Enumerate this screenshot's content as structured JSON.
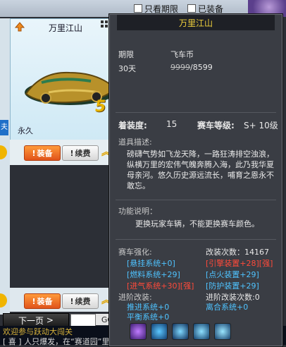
{
  "filters": {
    "only_expired": "只看期限",
    "equipped": "已装备"
  },
  "card": {
    "title": "万里江山",
    "duration": "永久",
    "level_badge": "5",
    "side_tab": "夫"
  },
  "rows": [
    {
      "equip": "装备",
      "renew": "续费"
    },
    {
      "equip": "装备",
      "renew": "续费"
    }
  ],
  "pager": {
    "next": "下一页",
    "go": "GC"
  },
  "chat": {
    "line1": "欢迎参与跃动大闯关",
    "line2": "[ 喜 ] 人只爆发，在“赛道园”里竞得都赢先一阶"
  },
  "tooltip": {
    "title": "万里江山",
    "period_label": "期限",
    "price_label": "飞车币",
    "period_value": "30天",
    "price_old": "9999",
    "price_new": "/8599",
    "wear_label": "着装度:",
    "wear_value": "15",
    "level_label": "赛车等级:",
    "level_value": "S+ 10级",
    "desc_heading": "道具描述:",
    "desc_text": "磅礴气势如飞龙天降，一路狂涛排空浊浪，纵横万里的宏伟气魄奔腾入海，此乃我华夏母亲河。悠久历史源远流长，哺育之恩永不敢忘。",
    "func_heading": "功能说明：",
    "func_text": "更换玩家车辆，不能更换赛车颜色。",
    "enhance_heading": "赛车强化:",
    "mod_count_label": "改装次数：",
    "mod_count_value": "14167",
    "enh_left": [
      "[悬挂系统+0]",
      "[燃料系统+29]",
      "[进气系统+30][强]"
    ],
    "enh_right": [
      "[引擎装置+28][强]",
      "[点火装置+29]",
      "[防护装置+29]"
    ],
    "adv_heading": "进阶改装:",
    "adv_count_label": "进阶改装次数:",
    "adv_count_value": "0",
    "adv_left": [
      "推进系统+0",
      "平衡系统+0"
    ],
    "adv_right": "离合系统+0"
  },
  "colors": {
    "accent_gold": "#f3d23c",
    "enh_blue": "#4fc3ff",
    "enh_red": "#ff4a3a"
  }
}
